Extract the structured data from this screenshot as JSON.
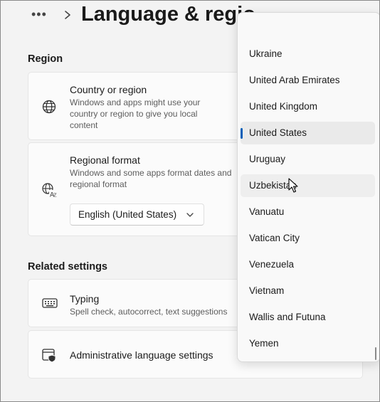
{
  "header": {
    "more_label": "•••",
    "title": "Language & regio"
  },
  "region": {
    "section_label": "Region",
    "country": {
      "title": "Country or region",
      "desc_lines": [
        "Windows and apps might use your",
        "country or region to give you local",
        "content"
      ]
    },
    "format": {
      "title": "Regional format",
      "desc_lines": [
        "Windows and some apps format dates and",
        "regional format"
      ],
      "selected_value": "English (United States)"
    }
  },
  "related": {
    "section_label": "Related settings",
    "typing": {
      "title": "Typing",
      "desc": "Spell check, autocorrect, text suggestions"
    },
    "admin": {
      "title": "Administrative language settings"
    }
  },
  "dropdown": {
    "items": [
      "Ukraine",
      "United Arab Emirates",
      "United Kingdom",
      "United States",
      "Uruguay",
      "Uzbekistan",
      "Vanuatu",
      "Vatican City",
      "Venezuela",
      "Vietnam",
      "Wallis and Futuna",
      "Yemen"
    ],
    "selected": "United States",
    "hovered": "Uzbekistan"
  },
  "colors": {
    "accent": "#005fb8",
    "background": "#f3f3f3",
    "card": "#fbfbfb"
  },
  "icons": {
    "globe": "globe-icon",
    "format": "language-format-icon",
    "keyboard": "keyboard-icon",
    "admin": "admin-shield-window-icon",
    "chevron": "chevron-right-icon",
    "caret": "chevron-down-icon"
  }
}
